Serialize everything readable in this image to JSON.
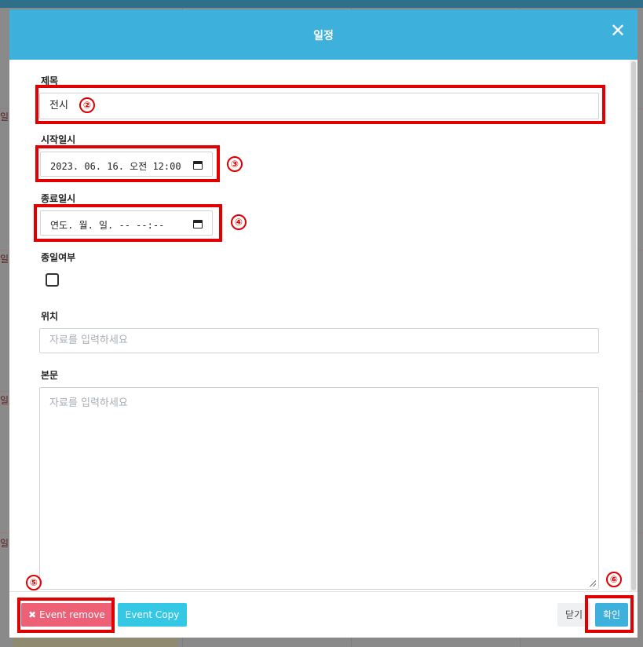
{
  "modal": {
    "title": "일정",
    "close_icon": "close-icon"
  },
  "form": {
    "title_label": "제목",
    "title_value": "전시",
    "start_label": "시작일시",
    "start_value": "2023. 06. 16. 오전 12:00",
    "end_label": "종료일시",
    "end_value": "연도. 월. 일. -- --:--",
    "allday_label": "종일여부",
    "allday_checked": false,
    "location_label": "위치",
    "location_placeholder": "자료를 입력하세요",
    "body_label": "본문",
    "body_placeholder": "자료를 입력하세요"
  },
  "footer": {
    "remove_label": "✖ Event remove",
    "copy_label": "Event Copy",
    "close_label": "닫기",
    "ok_label": "확인"
  },
  "annotations": {
    "m2": "②",
    "m3": "③",
    "m4": "④",
    "m5": "⑤",
    "m6": "⑥"
  },
  "backdrop": {
    "row_label": "일"
  },
  "colors": {
    "header": "#3eb0dc",
    "remove": "#ee6076",
    "copy": "#34c8e4",
    "highlight": "#e00000"
  }
}
